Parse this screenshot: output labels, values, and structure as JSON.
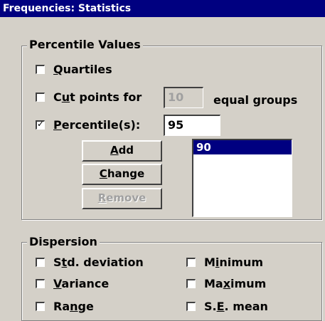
{
  "window": {
    "title": "Frequencies: Statistics"
  },
  "percentile_values": {
    "legend": "Percentile Values",
    "quartiles": {
      "pre": "",
      "key": "Q",
      "post": "uartiles",
      "checked": false
    },
    "cut_points": {
      "pre": "C",
      "key": "u",
      "post": "t points for",
      "value": "10",
      "suffix": "equal groups",
      "checked": false
    },
    "percentiles": {
      "pre": "",
      "key": "P",
      "post": "ercentile(s):",
      "value": "95",
      "checked": true
    },
    "add_button": {
      "pre": "",
      "key": "A",
      "post": "dd"
    },
    "change_button": {
      "pre": "",
      "key": "C",
      "post": "hange"
    },
    "remove_button": {
      "pre": "",
      "key": "R",
      "post": "emove"
    },
    "list": [
      "90"
    ]
  },
  "dispersion": {
    "legend": "Dispersion",
    "std_deviation": {
      "pre": "S",
      "key": "t",
      "post": "d. deviation",
      "checked": false
    },
    "minimum": {
      "pre": "M",
      "key": "i",
      "post": "nimum",
      "checked": false
    },
    "variance": {
      "pre": "",
      "key": "V",
      "post": "ariance",
      "checked": false
    },
    "maximum": {
      "pre": "Ma",
      "key": "x",
      "post": "imum",
      "checked": false
    },
    "range": {
      "pre": "Ra",
      "key": "n",
      "post": "ge",
      "checked": false
    },
    "se_mean": {
      "pre": "S.",
      "key": "E",
      "post": ". mean",
      "checked": false
    }
  }
}
